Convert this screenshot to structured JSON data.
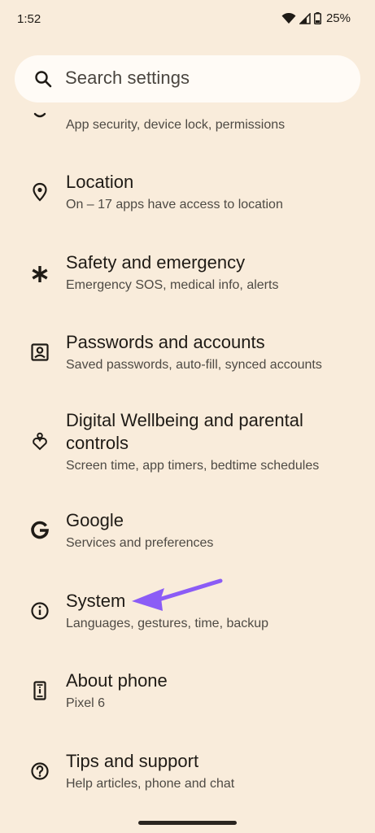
{
  "status_bar": {
    "time": "1:52",
    "battery": "25%"
  },
  "search": {
    "placeholder": "Search settings"
  },
  "items": [
    {
      "title": "",
      "subtitle": "App security, device lock, permissions",
      "icon": "security-icon"
    },
    {
      "title": "Location",
      "subtitle": "On – 17 apps have access to location",
      "icon": "location-pin-icon"
    },
    {
      "title": "Safety and emergency",
      "subtitle": "Emergency SOS, medical info, alerts",
      "icon": "asterisk-icon"
    },
    {
      "title": "Passwords and accounts",
      "subtitle": "Saved passwords, auto-fill, synced accounts",
      "icon": "account-box-icon"
    },
    {
      "title_line1": "Digital Wellbeing and parental",
      "title_line2": "controls",
      "subtitle": "Screen time, app timers, bedtime schedules",
      "icon": "wellbeing-icon"
    },
    {
      "title": "Google",
      "subtitle": "Services and preferences",
      "icon": "google-g-icon"
    },
    {
      "title": "System",
      "subtitle": "Languages, gestures, time, backup",
      "icon": "info-icon"
    },
    {
      "title": "About phone",
      "subtitle": "Pixel 6",
      "icon": "phone-icon"
    },
    {
      "title": "Tips and support",
      "subtitle": "Help articles, phone and chat",
      "icon": "help-icon"
    }
  ],
  "colors": {
    "background": "#f9ecdb",
    "search_background": "#fffbf6",
    "arrow": "#8b5cf6"
  }
}
